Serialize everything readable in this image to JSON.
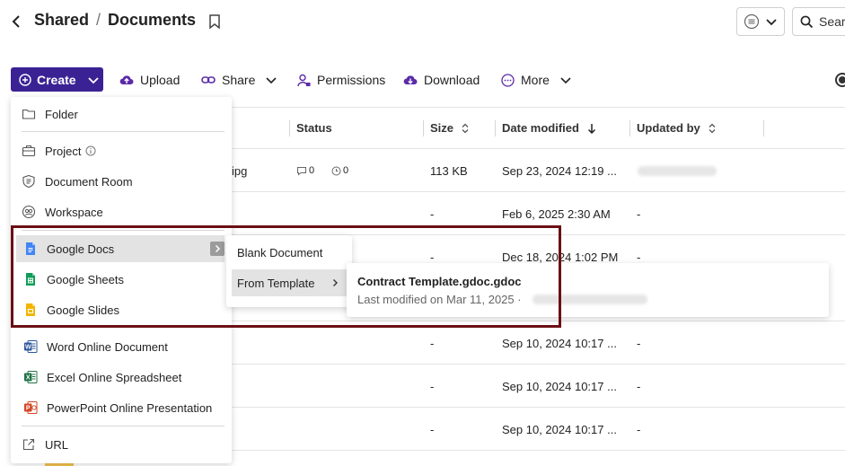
{
  "header": {
    "breadcrumb": [
      "Shared",
      "Documents"
    ],
    "breadcrumb_separator": "/",
    "search_placeholder": "Sear"
  },
  "toolbar": {
    "create": "Create",
    "upload": "Upload",
    "share": "Share",
    "permissions": "Permissions",
    "download": "Download",
    "more": "More"
  },
  "table": {
    "columns": [
      "Status",
      "Size",
      "Date modified",
      "Updated by"
    ],
    "rows": [
      {
        "name_fragment": "ipg",
        "comments": "0",
        "history": "0",
        "size": "113 KB",
        "date": "Sep 23, 2024 12:19 ...",
        "updated_by": ""
      },
      {
        "size": "-",
        "date": "Feb 6, 2025 2:30 AM",
        "updated_by": "-"
      },
      {
        "size": "-",
        "date": "Dec 18, 2024 1:02 PM",
        "updated_by": "-"
      },
      {
        "size": "-",
        "date": "Sep 10, 2024 10:17 ...",
        "updated_by": "-"
      },
      {
        "size": "-",
        "date": "Sep 10, 2024 10:17 ...",
        "updated_by": "-"
      },
      {
        "size": "-",
        "date": "Sep 10, 2024 10:17 ...",
        "updated_by": "-"
      }
    ]
  },
  "create_menu": {
    "folder": "Folder",
    "project": "Project",
    "document_room": "Document Room",
    "workspace": "Workspace",
    "google_docs": "Google Docs",
    "google_sheets": "Google Sheets",
    "google_slides": "Google Slides",
    "word_online": "Word Online Document",
    "excel_online": "Excel Online Spreadsheet",
    "powerpoint_online": "PowerPoint Online Presentation",
    "url": "URL"
  },
  "docs_submenu": {
    "blank": "Blank Document",
    "from_template": "From Template"
  },
  "template_submenu": {
    "name": "Contract Template.gdoc.gdoc",
    "modified": "Last modified on Mar 11, 2025 ·"
  },
  "colors": {
    "brand": "#3b2294",
    "highlight_border": "#6b0f14",
    "google_docs": "#4285f4",
    "google_sheets": "#0f9d58",
    "google_slides": "#f4b400",
    "word": "#2b579a",
    "excel": "#217346",
    "powerpoint": "#d24726"
  }
}
